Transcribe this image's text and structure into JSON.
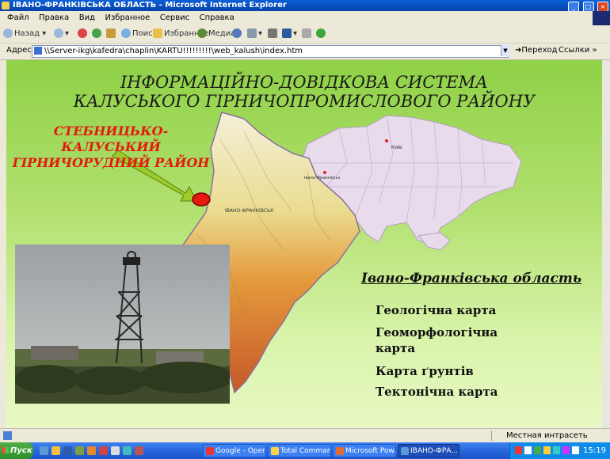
{
  "window": {
    "title": "ІВАНО-ФРАНКІВСЬКА ОБЛАСТЬ - Microsoft Internet Explorer",
    "controls": [
      "_",
      "□",
      "×"
    ]
  },
  "menu": [
    "Файл",
    "Правка",
    "Вид",
    "Избранное",
    "Сервис",
    "Справка"
  ],
  "toolbar": {
    "back": "Назад",
    "search": "Поиск",
    "favorites": "Избранное",
    "media": "Медиа"
  },
  "address": {
    "label": "Адрес:",
    "url": "\\\\Server-ikg\\kafedra\\chaplin\\KARTU!!!!!!!!!\\web_kalush\\index.htm",
    "go": "Переход",
    "links": "Ссылки"
  },
  "page": {
    "title_line1": "ІНФОРМАЦІЙНО-ДОВІДКОВА СИСТЕМА",
    "title_line2": "КАЛУСЬКОГО ГІРНИЧОПРОМИСЛОВОГО РАЙОНУ",
    "region_line1": "СТЕБНИЦЬКО-КАЛУСЬКИЙ",
    "region_line2": "ГІРНИЧОРУДНИЙ РАЙОН",
    "oblast": "Івано-Франківська область",
    "map_labels": {
      "kyiv": "Київ",
      "ivano_frankivsk": "Івано-Франківськ",
      "city": "ІВАНО-ФРАНКІВСЬК"
    },
    "links": [
      "Геологічна карта",
      "Геоморфологічна карта",
      "Карта ґрунтів",
      "Тектонічна карта"
    ]
  },
  "status": {
    "zone": "Местная интрасеть"
  },
  "taskbar": {
    "start": "Пуск",
    "tasks": [
      "Google - Opera",
      "Total Comman...",
      "Microsoft Pow...",
      "ІВАНО-ФРА..."
    ],
    "clock": "15:19"
  },
  "colors": {
    "title_bar": "#0a5fd8",
    "page_bg_top": "#8fd147",
    "page_bg_bottom": "#e8f9c4",
    "region_text": "#e4190f",
    "arrow": "#9ccc2a"
  }
}
